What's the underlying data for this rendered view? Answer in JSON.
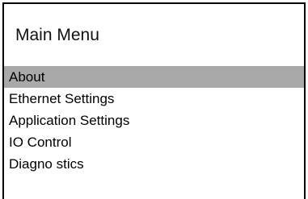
{
  "menu": {
    "title": "Main Menu",
    "selected_index": 0,
    "items": [
      {
        "label": "About"
      },
      {
        "label": "Ethernet Settings"
      },
      {
        "label": "Application Settings"
      },
      {
        "label": "IO Control"
      },
      {
        "label": "Diagno stics"
      }
    ]
  },
  "colors": {
    "selection_background": "#a9a9a9",
    "frame": "#000000",
    "background": "#ffffff"
  }
}
